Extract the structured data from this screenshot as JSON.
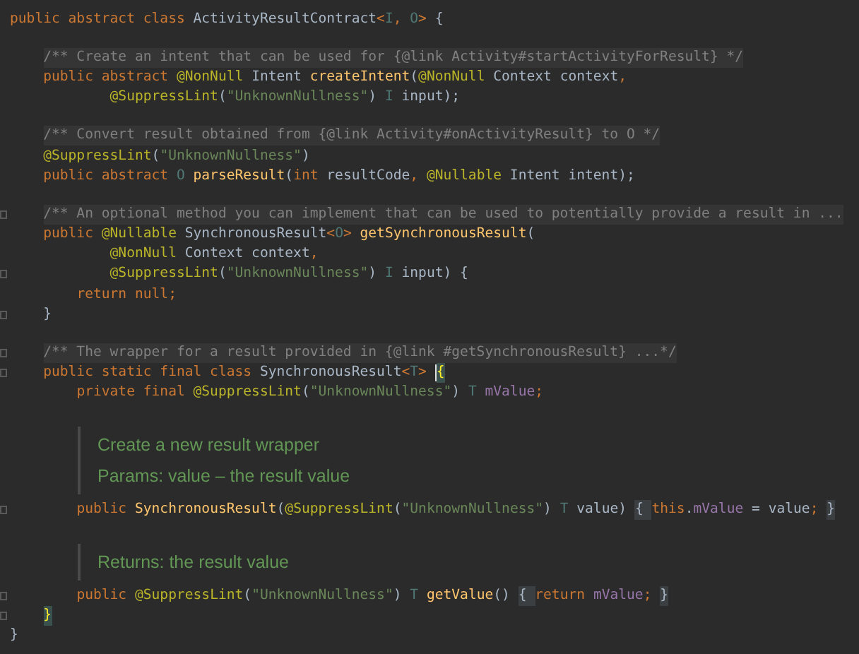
{
  "editor": {
    "lines": [
      {
        "kind": "code",
        "fold": false,
        "tokens": [
          {
            "text": "public abstract class ",
            "kind": "keyword"
          },
          {
            "text": "ActivityResultContract",
            "kind": "plain"
          },
          {
            "text": "<",
            "kind": "keyword"
          },
          {
            "text": "I",
            "kind": "typeparam"
          },
          {
            "text": ", ",
            "kind": "keyword"
          },
          {
            "text": "O",
            "kind": "typeparam"
          },
          {
            "text": "> ",
            "kind": "keyword"
          },
          {
            "text": "{",
            "kind": "brace"
          }
        ]
      },
      {
        "kind": "blank"
      },
      {
        "kind": "comment",
        "fold": false,
        "tokens": [
          {
            "text": "    /** Create an intent that can be used for {@link Activity#startActivityForResult} */",
            "kind": "comment"
          }
        ]
      },
      {
        "kind": "code",
        "fold": false,
        "tokens": [
          {
            "text": "    public abstract ",
            "kind": "keyword"
          },
          {
            "text": "@NonNull ",
            "kind": "annotation"
          },
          {
            "text": "Intent ",
            "kind": "plain"
          },
          {
            "text": "createIntent",
            "kind": "method"
          },
          {
            "text": "(",
            "kind": "brace"
          },
          {
            "text": "@NonNull ",
            "kind": "annotation"
          },
          {
            "text": "Context context",
            "kind": "plain"
          },
          {
            "text": ",",
            "kind": "keyword"
          }
        ]
      },
      {
        "kind": "code",
        "fold": false,
        "tokens": [
          {
            "text": "            @SuppressLint",
            "kind": "annotation"
          },
          {
            "text": "(",
            "kind": "brace"
          },
          {
            "text": "\"UnknownNullness\"",
            "kind": "string"
          },
          {
            "text": ") ",
            "kind": "brace"
          },
          {
            "text": "I ",
            "kind": "typeparam"
          },
          {
            "text": "input",
            "kind": "plain"
          },
          {
            "text": ");",
            "kind": "brace"
          }
        ]
      },
      {
        "kind": "blank"
      },
      {
        "kind": "comment",
        "fold": false,
        "tokens": [
          {
            "text": "    /** Convert result obtained from {@link Activity#onActivityResult} to O */",
            "kind": "comment"
          }
        ]
      },
      {
        "kind": "code",
        "fold": false,
        "tokens": [
          {
            "text": "    @SuppressLint",
            "kind": "annotation"
          },
          {
            "text": "(",
            "kind": "brace"
          },
          {
            "text": "\"UnknownNullness\"",
            "kind": "string"
          },
          {
            "text": ")",
            "kind": "brace"
          }
        ]
      },
      {
        "kind": "code",
        "fold": false,
        "tokens": [
          {
            "text": "    public abstract ",
            "kind": "keyword"
          },
          {
            "text": "O ",
            "kind": "typeparam"
          },
          {
            "text": "parseResult",
            "kind": "method"
          },
          {
            "text": "(",
            "kind": "brace"
          },
          {
            "text": "int ",
            "kind": "keyword"
          },
          {
            "text": "resultCode",
            "kind": "plain"
          },
          {
            "text": ", ",
            "kind": "keyword"
          },
          {
            "text": "@Nullable ",
            "kind": "annotation"
          },
          {
            "text": "Intent intent",
            "kind": "plain"
          },
          {
            "text": ");",
            "kind": "brace"
          }
        ]
      },
      {
        "kind": "blank"
      },
      {
        "kind": "comment",
        "fold": true,
        "tokens": [
          {
            "text": "    /** An optional method you can implement that can be used to potentially provide a result in ...",
            "kind": "comment"
          }
        ]
      },
      {
        "kind": "code",
        "fold": false,
        "tokens": [
          {
            "text": "    public ",
            "kind": "keyword"
          },
          {
            "text": "@Nullable ",
            "kind": "annotation"
          },
          {
            "text": "SynchronousResult",
            "kind": "plain"
          },
          {
            "text": "<",
            "kind": "keyword"
          },
          {
            "text": "O",
            "kind": "typeparam"
          },
          {
            "text": "> ",
            "kind": "keyword"
          },
          {
            "text": "getSynchronousResult",
            "kind": "method"
          },
          {
            "text": "(",
            "kind": "brace"
          }
        ]
      },
      {
        "kind": "code",
        "fold": false,
        "tokens": [
          {
            "text": "            @NonNull ",
            "kind": "annotation"
          },
          {
            "text": "Context context",
            "kind": "plain"
          },
          {
            "text": ",",
            "kind": "keyword"
          }
        ]
      },
      {
        "kind": "code",
        "fold": true,
        "tokens": [
          {
            "text": "            @SuppressLint",
            "kind": "annotation"
          },
          {
            "text": "(",
            "kind": "brace"
          },
          {
            "text": "\"UnknownNullness\"",
            "kind": "string"
          },
          {
            "text": ") ",
            "kind": "brace"
          },
          {
            "text": "I ",
            "kind": "typeparam"
          },
          {
            "text": "input",
            "kind": "plain"
          },
          {
            "text": ") ",
            "kind": "brace"
          },
          {
            "text": "{",
            "kind": "block"
          }
        ]
      },
      {
        "kind": "code",
        "fold": false,
        "tokens": [
          {
            "text": "        return null",
            "kind": "keyword"
          },
          {
            "text": ";",
            "kind": "keyword"
          }
        ]
      },
      {
        "kind": "code",
        "fold": true,
        "tokens": [
          {
            "text": "    }",
            "kind": "block"
          }
        ]
      },
      {
        "kind": "blank"
      },
      {
        "kind": "comment",
        "fold": true,
        "tokens": [
          {
            "text": "    /** The wrapper for a result provided in {@link #getSynchronousResult} ...*/",
            "kind": "comment"
          }
        ]
      },
      {
        "kind": "code",
        "fold": true,
        "tokens": [
          {
            "text": "    public static final class ",
            "kind": "keyword"
          },
          {
            "text": "SynchronousResult",
            "kind": "plain"
          },
          {
            "text": "<",
            "kind": "keyword"
          },
          {
            "text": "T",
            "kind": "typeparam"
          },
          {
            "text": "> ",
            "kind": "keyword"
          },
          {
            "text": "{",
            "kind": "match",
            "caret": true
          }
        ]
      },
      {
        "kind": "code",
        "fold": false,
        "tokens": [
          {
            "text": "        private final ",
            "kind": "keyword"
          },
          {
            "text": "@SuppressLint",
            "kind": "annotation"
          },
          {
            "text": "(",
            "kind": "brace"
          },
          {
            "text": "\"UnknownNullness\"",
            "kind": "string"
          },
          {
            "text": ") ",
            "kind": "brace"
          },
          {
            "text": "T ",
            "kind": "typeparam"
          },
          {
            "text": "mValue",
            "kind": "field"
          },
          {
            "text": ";",
            "kind": "keyword"
          }
        ]
      },
      {
        "kind": "blank"
      },
      {
        "kind": "doc",
        "lines": [
          "Create a new result wrapper",
          "Params: value – the result value"
        ]
      },
      {
        "kind": "code",
        "fold": true,
        "tokens": [
          {
            "text": "        public ",
            "kind": "keyword"
          },
          {
            "text": "SynchronousResult",
            "kind": "method"
          },
          {
            "text": "(",
            "kind": "brace"
          },
          {
            "text": "@SuppressLint",
            "kind": "annotation"
          },
          {
            "text": "(",
            "kind": "brace"
          },
          {
            "text": "\"UnknownNullness\"",
            "kind": "string"
          },
          {
            "text": ") ",
            "kind": "brace"
          },
          {
            "text": "T ",
            "kind": "typeparam"
          },
          {
            "text": "value",
            "kind": "plain"
          },
          {
            "text": ") ",
            "kind": "brace"
          },
          {
            "text": "{ ",
            "kind": "folded"
          },
          {
            "text": "this",
            "kind": "keyword"
          },
          {
            "text": ".",
            "kind": "plain"
          },
          {
            "text": "mValue ",
            "kind": "field"
          },
          {
            "text": "= value",
            "kind": "plain"
          },
          {
            "text": "; ",
            "kind": "keyword"
          },
          {
            "text": "}",
            "kind": "folded"
          }
        ]
      },
      {
        "kind": "blank"
      },
      {
        "kind": "doc",
        "lines": [
          "Returns: the result value"
        ]
      },
      {
        "kind": "code",
        "fold": true,
        "tokens": [
          {
            "text": "        public ",
            "kind": "keyword"
          },
          {
            "text": "@SuppressLint",
            "kind": "annotation"
          },
          {
            "text": "(",
            "kind": "brace"
          },
          {
            "text": "\"UnknownNullness\"",
            "kind": "string"
          },
          {
            "text": ") ",
            "kind": "brace"
          },
          {
            "text": "T ",
            "kind": "typeparam"
          },
          {
            "text": "getValue",
            "kind": "method"
          },
          {
            "text": "() ",
            "kind": "brace"
          },
          {
            "text": "{ ",
            "kind": "folded"
          },
          {
            "text": "return ",
            "kind": "keyword"
          },
          {
            "text": "mValue",
            "kind": "field"
          },
          {
            "text": "; ",
            "kind": "keyword"
          },
          {
            "text": "}",
            "kind": "folded"
          }
        ]
      },
      {
        "kind": "code",
        "fold": true,
        "tokens": [
          {
            "text": "    }",
            "kind": "match"
          }
        ]
      },
      {
        "kind": "code",
        "fold": false,
        "tokens": [
          {
            "text": "}",
            "kind": "brace"
          }
        ]
      }
    ]
  }
}
